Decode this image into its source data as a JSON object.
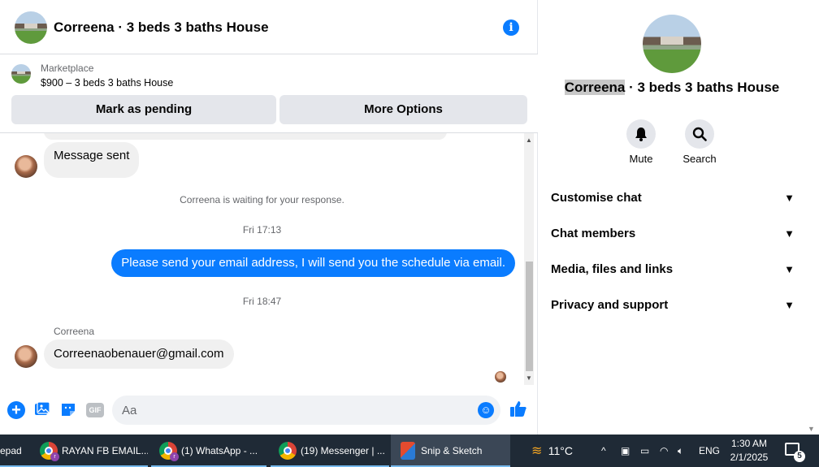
{
  "chat": {
    "title": "Correena · 3 beds 3 baths House",
    "marketplace_label": "Marketplace",
    "listing": "$900 – 3 beds 3 baths House",
    "mark_pending_label": "Mark as pending",
    "more_options_label": "More Options"
  },
  "messages": {
    "first_incoming": "Message sent",
    "waiting_notice": "Correena is waiting for your response.",
    "time_1": "Fri 17:13",
    "outgoing": "Please send your email address, I will send you the schedule via email.",
    "time_2": "Fri 18:47",
    "sender_name": "Correena",
    "second_incoming": "Correenaobenauer@gmail.com"
  },
  "composer": {
    "placeholder": "Aa",
    "gif_label": "GIF"
  },
  "info_panel": {
    "title_name": "Correena",
    "title_rest": " · 3 beds 3 baths House",
    "mute_label": "Mute",
    "search_label": "Search",
    "sections": [
      {
        "label": "Customise chat"
      },
      {
        "label": "Chat members"
      },
      {
        "label": "Media, files and links"
      },
      {
        "label": "Privacy and support"
      }
    ]
  },
  "taskbar": {
    "items": [
      {
        "label": "epad"
      },
      {
        "label": "RAYAN FB EMAIL..."
      },
      {
        "label": "(1) WhatsApp - ..."
      },
      {
        "label": "(19) Messenger | ..."
      },
      {
        "label": "Snip & Sketch"
      }
    ],
    "weather": "11°C",
    "language": "ENG",
    "time": "1:30 AM",
    "date": "2/1/2025",
    "profile_letter": "r",
    "notification_count": "5"
  },
  "colors": {
    "accent": "#0a7cff",
    "taskbar_bg": "#1f2a36"
  }
}
